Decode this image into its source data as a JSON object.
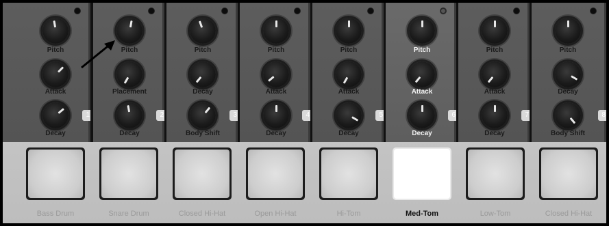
{
  "modules": [
    {
      "knobs": [
        "Pitch",
        "Attack",
        "Decay"
      ],
      "index": "1"
    },
    {
      "knobs": [
        "Pitch",
        "Placement",
        "Decay"
      ],
      "index": "2"
    },
    {
      "knobs": [
        "Pitch",
        "Decay",
        "Body Shift"
      ],
      "index": "3"
    },
    {
      "knobs": [
        "Pitch",
        "Attack",
        "Decay"
      ],
      "index": "4"
    },
    {
      "knobs": [
        "Pitch",
        "Attack",
        "Decay"
      ],
      "index": "5"
    },
    {
      "knobs": [
        "Pitch",
        "Attack",
        "Decay"
      ],
      "index": "6"
    },
    {
      "knobs": [
        "Pitch",
        "Attack",
        "Decay"
      ],
      "index": "7"
    },
    {
      "knobs": [
        "Pitch",
        "Decay",
        "Body Shift"
      ],
      "index": "8"
    }
  ],
  "pads": [
    "Bass Drum",
    "Snare Drum",
    "Closed Hi-Hat",
    "Open Hi-Hat",
    "Hi-Tom",
    "Med-Tom",
    "Low-Tom",
    "Closed Hi-Hat"
  ],
  "selected_index": 5,
  "colors": {
    "panel": "#585858",
    "selected_pad": "#ffffff",
    "pad": "#d4d4d4"
  }
}
